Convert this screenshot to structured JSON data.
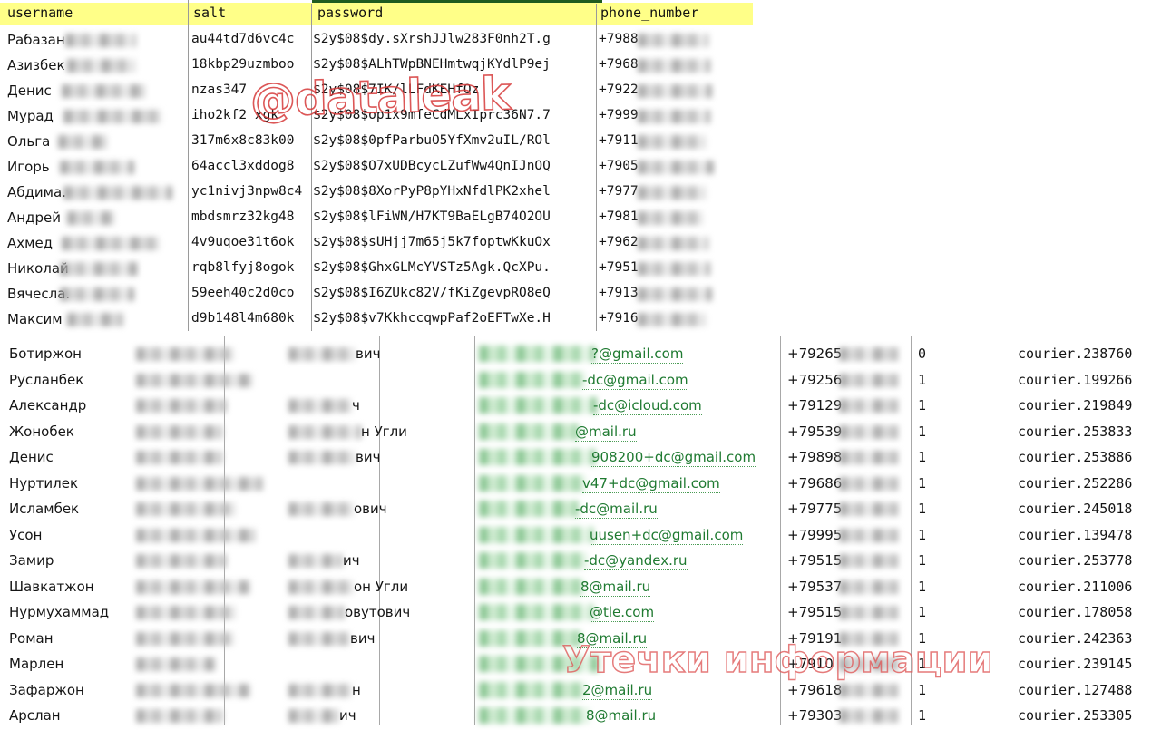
{
  "top_table": {
    "headers": [
      "username",
      "salt",
      "password",
      "phone_number"
    ],
    "header_bg": "#ffff88",
    "green_bar_color": "#1f5c1f",
    "rows": [
      {
        "username": "Рабазан",
        "salt": "au44td7d6vc4c",
        "password": "$2y$08$dy.sXrshJJlw283F0nh2T.g",
        "phone_number": "+7988"
      },
      {
        "username": "Азизбек",
        "salt": "18kbp29uzmboo",
        "password": "$2y$08$ALhTWpBNEHmtwqjKYdlP9ej",
        "phone_number": "+7968"
      },
      {
        "username": "Денис",
        "salt": "nzas347",
        "password": "$2y$08$7IK/lLFdKEHfOz",
        "phone_number": "+7922"
      },
      {
        "username": "Мурад",
        "salt": "iho2kf2 xgk",
        "password": "$2y$08$op1x9mfeCdMLxIprc36N7.7",
        "phone_number": "+7999"
      },
      {
        "username": "Ольга",
        "salt": "317m6x8c83k00",
        "password": "$2y$08$0pfParbuO5YfXmv2uIL/ROl",
        "phone_number": "+7911"
      },
      {
        "username": "Игорь",
        "salt": "64accl3xddog8",
        "password": "$2y$08$O7xUDBcycLZufWw4QnIJnOQ",
        "phone_number": "+7905"
      },
      {
        "username": "Абдима.",
        "salt": "yc1nivj3npw8c4",
        "password": "$2y$08$8XorPyP8pYHxNfdlPK2xhel",
        "phone_number": "+7977"
      },
      {
        "username": "Андрей",
        "salt": "mbdsmrz32kg48",
        "password": "$2y$08$lFiWN/H7KT9BaELgB74O2OU",
        "phone_number": "+7981"
      },
      {
        "username": "Ахмед",
        "salt": "4v9uqoe31t6ok",
        "password": "$2y$08$sUHjj7m65j5k7foptwKkuOx",
        "phone_number": "+7962"
      },
      {
        "username": "Николай",
        "salt": "rqb8lfyj8ogok",
        "password": "$2y$08$GhxGLMcYVSTz5Agk.QcXPu.",
        "phone_number": "+7951"
      },
      {
        "username": "Вячесла.",
        "salt": "59eeh40c2d0co",
        "password": "$2y$08$I6ZUkc82V/fKiZgevpRO8eQ",
        "phone_number": "+7913"
      },
      {
        "username": "Максим",
        "salt": "d9b148l4m680k",
        "password": "$2y$08$v7KkhccqwpPaf2oEFTwXe.H",
        "phone_number": "+7916"
      }
    ]
  },
  "bottom_table": {
    "rows": [
      {
        "first_name": "Ботиржон",
        "patronymic_suffix": "вич",
        "email_suffix": "?@gmail.com",
        "phone": "+79265",
        "flag": "0",
        "courier": "courier.238760"
      },
      {
        "first_name": "Русланбек",
        "patronymic_suffix": "",
        "email_suffix": "-dc@gmail.com",
        "phone": "+79256",
        "flag": "1",
        "courier": "courier.199266"
      },
      {
        "first_name": "Александр",
        "patronymic_suffix": "ч",
        "email_suffix": "-dc@icloud.com",
        "phone": "+79129",
        "flag": "1",
        "courier": "courier.219849"
      },
      {
        "first_name": "Жонобек",
        "patronymic_suffix": "н Угли",
        "email_suffix": "@mail.ru",
        "phone": "+79539",
        "flag": "1",
        "courier": "courier.253833"
      },
      {
        "first_name": "Денис",
        "patronymic_suffix": "вич",
        "email_suffix": "908200+dc@gmail.com",
        "phone": "+79898",
        "flag": "1",
        "courier": "courier.253886"
      },
      {
        "first_name": "Нуртилек",
        "patronymic_suffix": "",
        "email_suffix": "v47+dc@gmail.com",
        "phone": "+79686",
        "flag": "1",
        "courier": "courier.252286"
      },
      {
        "first_name": "Исламбек",
        "patronymic_suffix": "ович",
        "email_suffix": "-dc@mail.ru",
        "phone": "+79775",
        "flag": "1",
        "courier": "courier.245018"
      },
      {
        "first_name": "Усон",
        "patronymic_suffix": "",
        "email_suffix": "uusen+dc@gmail.com",
        "phone": "+79995",
        "flag": "1",
        "courier": "courier.139478"
      },
      {
        "first_name": "Замир",
        "patronymic_suffix": "ич",
        "email_suffix": "-dc@yandex.ru",
        "phone": "+79515",
        "flag": "1",
        "courier": "courier.253778"
      },
      {
        "first_name": "Шавкатжон",
        "patronymic_suffix": "он Угли",
        "email_suffix": "8@mail.ru",
        "phone": "+79537",
        "flag": "1",
        "courier": "courier.211006"
      },
      {
        "first_name": "Нурмухаммад",
        "patronymic_suffix": "овутович",
        "email_suffix": "@tle.com",
        "phone": "+79515",
        "flag": "1",
        "courier": "courier.178058"
      },
      {
        "first_name": "Роман",
        "patronymic_suffix": "вич",
        "email_suffix": "8@mail.ru",
        "phone": "+79191",
        "flag": "1",
        "courier": "courier.242363"
      },
      {
        "first_name": "Марлен",
        "patronymic_suffix": "",
        "email_suffix": "",
        "phone": "+7910",
        "flag": "1",
        "courier": "courier.239145"
      },
      {
        "first_name": "Зафаржон",
        "patronymic_suffix": "н",
        "email_suffix": "2@mail.ru",
        "phone": "+79618",
        "flag": "1",
        "courier": "courier.127488"
      },
      {
        "first_name": "Арслан",
        "patronymic_suffix": "ич",
        "email_suffix": "8@mail.ru",
        "phone": "+79303",
        "flag": "1",
        "courier": "courier.253305"
      }
    ]
  },
  "watermarks": {
    "top": "@dataleak",
    "bottom": "Утечки информации",
    "color": "#d63a3a"
  }
}
